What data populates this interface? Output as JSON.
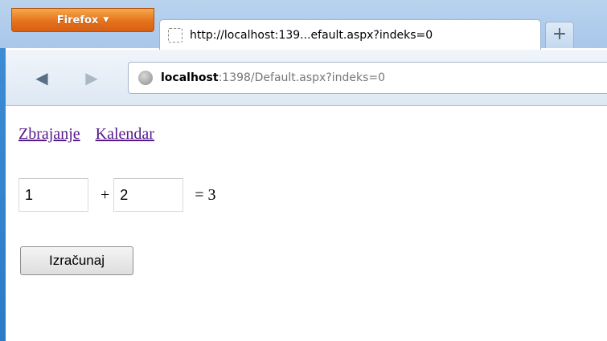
{
  "browser": {
    "menu_button_label": "Firefox",
    "menu_button_caret": "▼",
    "tab_title": "http://localhost:139...efault.aspx?indeks=0",
    "new_tab_label": "+",
    "back_icon": "◀",
    "forward_icon": "▶",
    "url_host": "localhost",
    "url_rest": ":1398/Default.aspx?indeks=0"
  },
  "page": {
    "links": [
      "Zbrajanje",
      "Kalendar"
    ],
    "calculator": {
      "first_value": "1",
      "plus_sign": "+",
      "second_value": "2",
      "result_text": "= 3",
      "button_label": "Izračunaj"
    }
  },
  "colors": {
    "firefox_orange": "#e5731d",
    "visited_link": "#551a8b",
    "chrome_blue": "#a8c7ea"
  }
}
